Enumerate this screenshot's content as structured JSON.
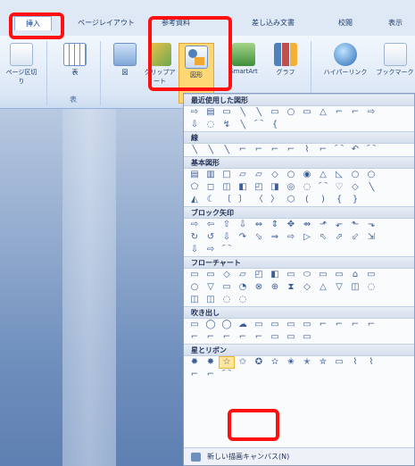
{
  "tabs": [
    {
      "label": "挿入",
      "active": true
    },
    {
      "label": "ページレイアウト",
      "active": false
    },
    {
      "label": "参考資料",
      "active": false
    },
    {
      "label": "差し込み文書",
      "active": false
    },
    {
      "label": "校閲",
      "active": false
    },
    {
      "label": "表示",
      "active": false
    }
  ],
  "ribbon": {
    "buttons": [
      "ページ区切り",
      "表",
      "図",
      "クリップアート",
      "図形",
      "SmartArt",
      "グラフ",
      "ハイパーリンク",
      "ブックマーク"
    ],
    "group_label": "表"
  },
  "shapes_menu": {
    "categories": [
      {
        "label": "最近使用した図形",
        "rows": [
          [
            "⇨",
            "▤",
            "▭",
            "╲",
            "╲",
            "▭",
            "○",
            "▭",
            "△",
            "⌐",
            "⌐",
            "⇨"
          ],
          [
            "⇩",
            "◌",
            "↯",
            "╲",
            "⌒",
            "{"
          ]
        ]
      },
      {
        "label": "線",
        "rows": [
          [
            "╲",
            "╲",
            "╲",
            "⌐",
            "⌐",
            "⌐",
            "⌐",
            "⌇",
            "⌐",
            "⌒",
            "↶",
            "⌒"
          ]
        ]
      },
      {
        "label": "基本図形",
        "rows": [
          [
            "▤",
            "▥",
            "□",
            "▱",
            "▱",
            "◇",
            "○",
            "◉",
            "△",
            "◺",
            "○",
            "○"
          ],
          [
            "⬠",
            "◻",
            "◫",
            "◧",
            "◰",
            "◨",
            "◎",
            "◌",
            "⌒",
            "♡",
            "◇",
            "╲"
          ],
          [
            "◭",
            "☾",
            "〔",
            "〕",
            "〈",
            "〉",
            "⬡",
            "(",
            ")",
            "{",
            "}"
          ]
        ]
      },
      {
        "label": "ブロック矢印",
        "rows": [
          [
            "⇨",
            "⇦",
            "⇧",
            "⇩",
            "⇔",
            "⇕",
            "✥",
            "⇴",
            "⬏",
            "⬐",
            "⬑",
            "⬎"
          ],
          [
            "↻",
            "↺",
            "⇩",
            "↷",
            "⬂",
            "⇒",
            "⇨",
            "▷",
            "⬁",
            "⬀",
            "⬃",
            "⇲"
          ],
          [
            "⇩",
            "⇨",
            "⌒"
          ]
        ]
      },
      {
        "label": "フローチャート",
        "rows": [
          [
            "▭",
            "▭",
            "◇",
            "▱",
            "◰",
            "◧",
            "▭",
            "⬭",
            "▭",
            "▭",
            "⌂",
            "▭"
          ],
          [
            "○",
            "▽",
            "▭",
            "◔",
            "⊗",
            "⊕",
            "⧗",
            "◇",
            "△",
            "▽",
            "◫",
            "◌"
          ],
          [
            "◫",
            "◫",
            "◌",
            "◌"
          ]
        ]
      },
      {
        "label": "吹き出し",
        "rows": [
          [
            "▭",
            "◯",
            "◯",
            "☁",
            "▭",
            "▭",
            "▭",
            "▭",
            "⌐",
            "⌐",
            "⌐",
            "⌐"
          ],
          [
            "⌐",
            "⌐",
            "⌐",
            "⌐",
            "⌐",
            "▭",
            "▭",
            "▭"
          ]
        ]
      },
      {
        "label": "星とリボン",
        "rows": [
          [
            "✹",
            "✸",
            "☆",
            "✩",
            "✪",
            "✫",
            "✬",
            "✭",
            "✮",
            "▭",
            "⌇",
            "⌇"
          ],
          [
            "⌐",
            "⌐",
            "⌒"
          ]
        ]
      }
    ],
    "footer": "新しい描画キャンバス(N)"
  }
}
